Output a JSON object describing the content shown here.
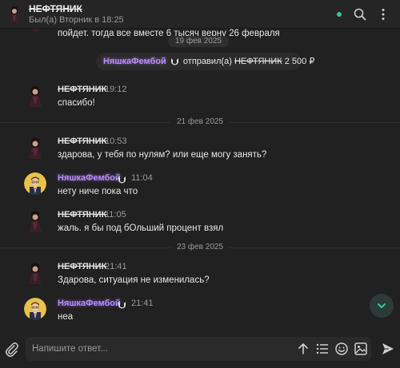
{
  "header": {
    "contact_name": "НЕФТЯНИК",
    "status": "Был(а) Вторник в 18:25",
    "online_color": "#2ecc8a"
  },
  "chat": {
    "partial_top_text": "пойдет. тогда все вместе 6 тысяч верну 26 февраля",
    "date_pill_1": "19 фев 2025",
    "transfer": {
      "sender": "НяшкаФембой",
      "action": "отправил(а)",
      "recipient": "НЕФТЯНИК",
      "amount": "2 500 ₽"
    },
    "messages": [
      {
        "author": "НЕФТЯНИК",
        "time": "19:12",
        "text": "спасибо!"
      },
      {
        "author": "НЕФТЯНИК",
        "time": "10:53",
        "text": "здарова, у тебя по нулям? или еще могу занять?"
      },
      {
        "author": "НяшкаФембой",
        "time": "11:04",
        "text": "нету ниче пока что"
      },
      {
        "author": "НЕФТЯНИК",
        "time": "11:05",
        "text": "жаль. я бы под бОльший процент взял"
      },
      {
        "author": "НЕФТЯНИК",
        "time": "21:41",
        "text": "Здарова, ситуация не изменилась?"
      },
      {
        "author": "НяшкаФембой",
        "time": "21:41",
        "text": "неа"
      }
    ],
    "divider_1": "21 фев 2025",
    "divider_2": "23 фев 2025"
  },
  "composer": {
    "placeholder": "Напишите ответ..."
  },
  "colors": {
    "background": "#212121",
    "accent_purple": "#b98aff",
    "accent_green": "#2ecc8a"
  },
  "icons": [
    "avatar-icon",
    "search-icon",
    "more-icon",
    "badge-icon",
    "chevron-down-icon",
    "paperclip-icon",
    "format-up-icon",
    "list-icon",
    "emoji-icon",
    "image-icon",
    "send-icon"
  ]
}
